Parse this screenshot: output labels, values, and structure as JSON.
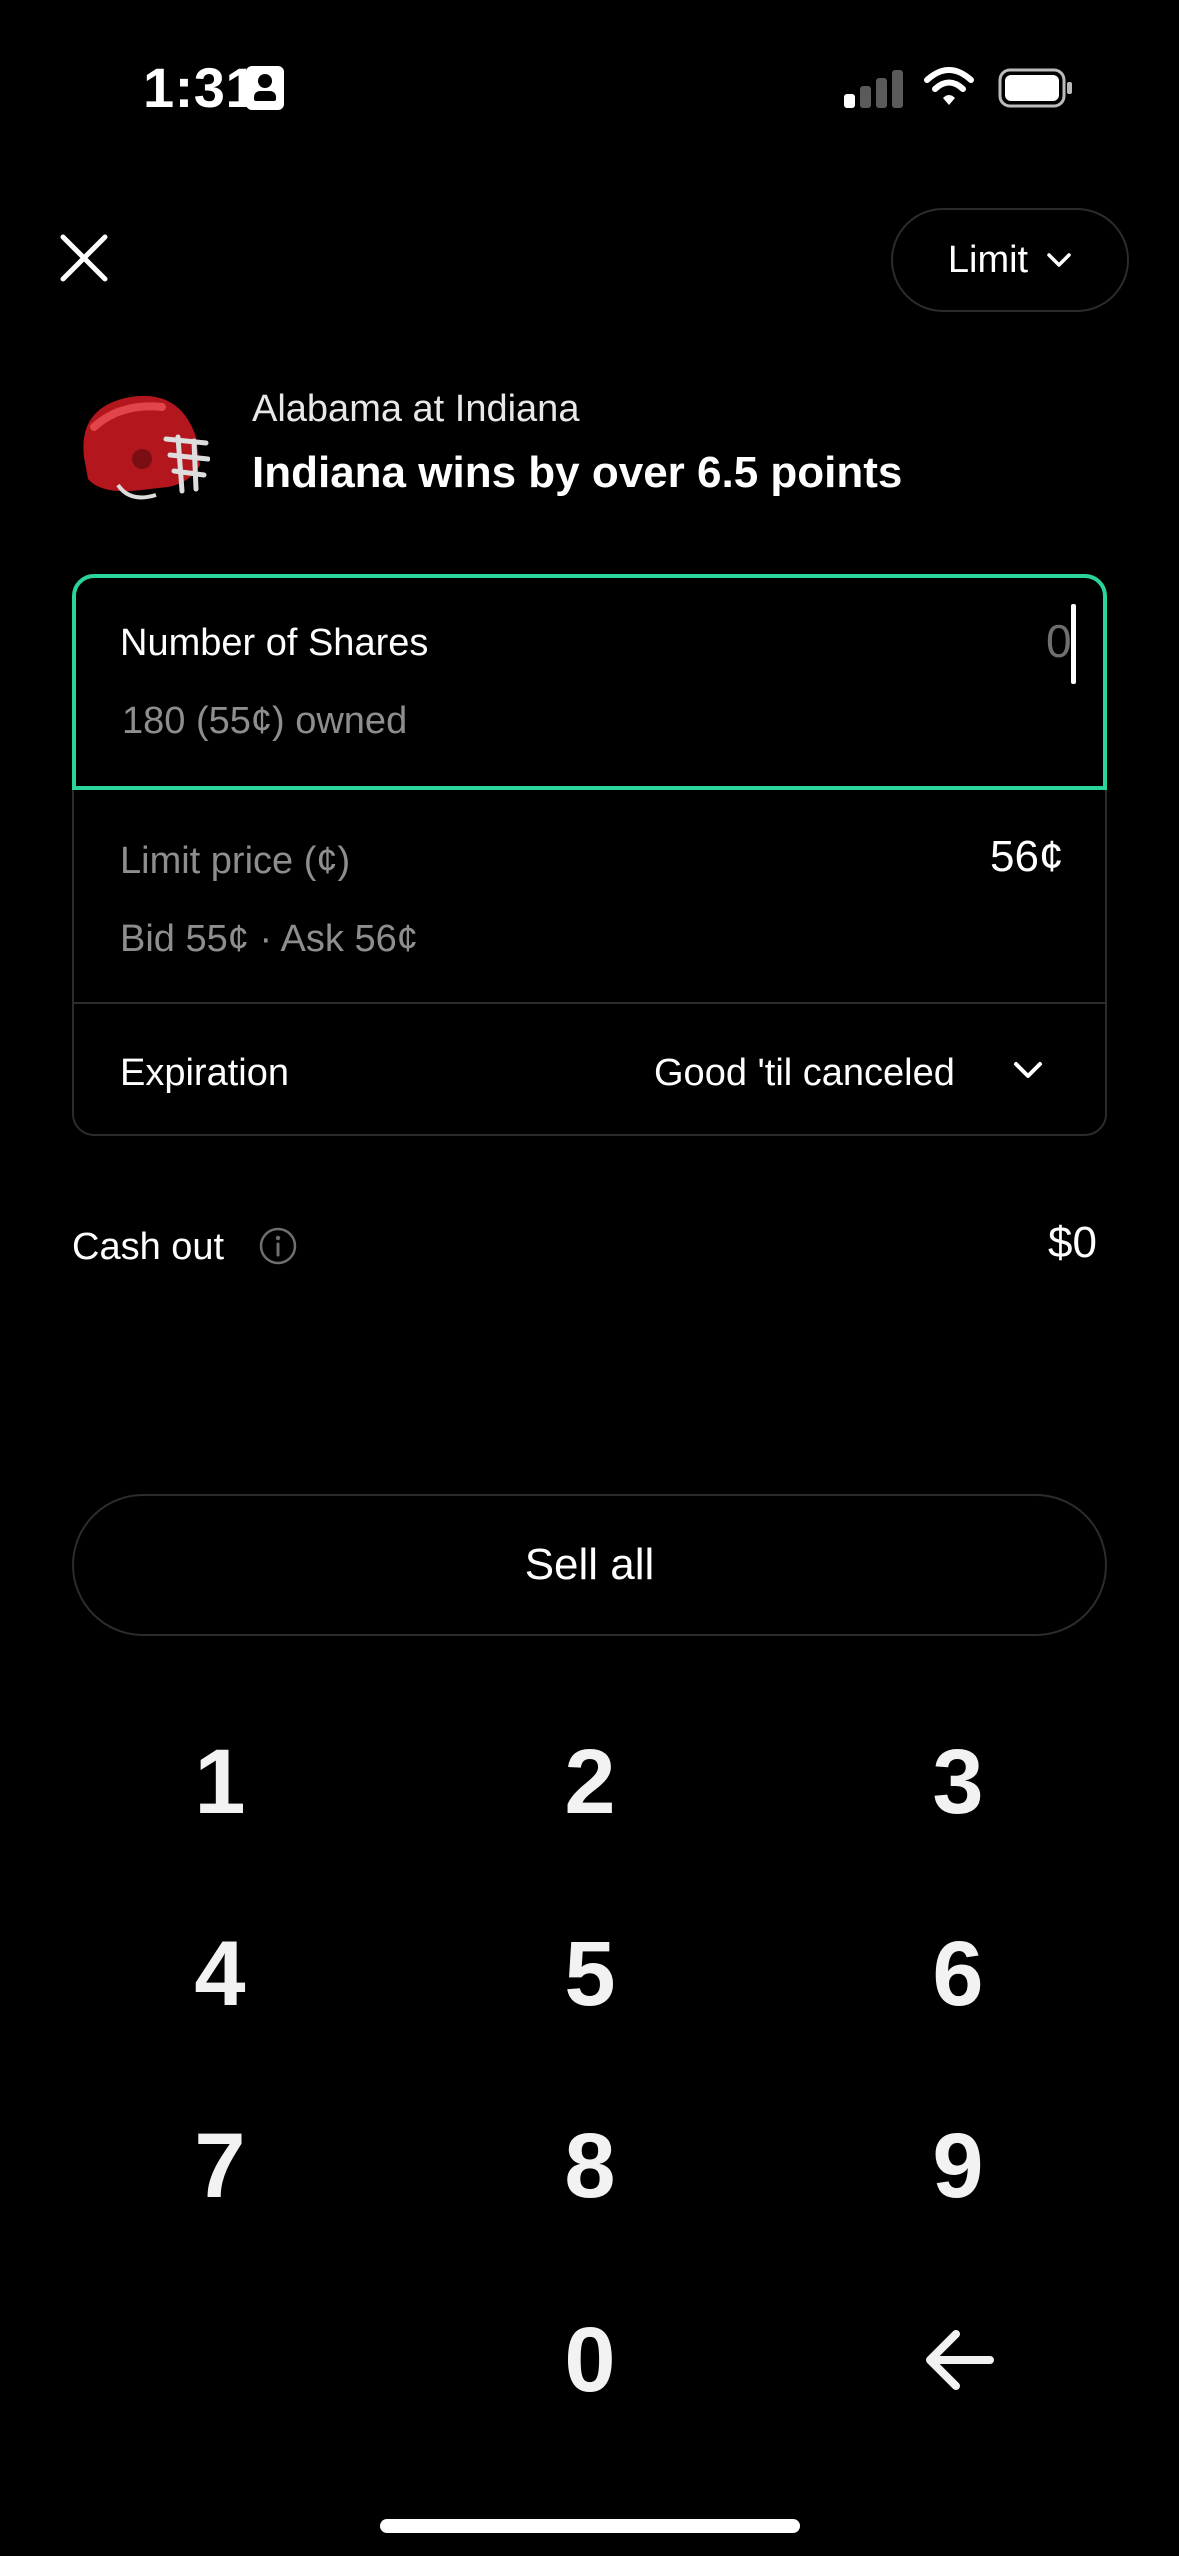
{
  "status_bar": {
    "time": "1:31"
  },
  "header": {
    "order_type": "Limit"
  },
  "event": {
    "matchup": "Alabama at Indiana",
    "market": "Indiana wins by over 6.5 points"
  },
  "order": {
    "shares_label": "Number of Shares",
    "shares_value": "0",
    "owned_text": "180 (55¢) owned",
    "limit_label": "Limit price (¢)",
    "limit_value": "56¢",
    "bid_ask": "Bid 55¢ · Ask 56¢",
    "expiration_label": "Expiration",
    "expiration_value": "Good 'til canceled"
  },
  "cash_out": {
    "label": "Cash out",
    "value": "$0"
  },
  "sell_all_label": "Sell all",
  "keypad": [
    "1",
    "2",
    "3",
    "4",
    "5",
    "6",
    "7",
    "8",
    "9",
    "0"
  ],
  "colors": {
    "accent": "#2bd49a",
    "background": "#000000",
    "muted": "#8e8e8e"
  },
  "icons": [
    "id-card-icon",
    "signal-icon",
    "wifi-icon",
    "battery-icon",
    "close-icon",
    "chevron-down-icon",
    "helmet-icon",
    "info-icon",
    "backspace-icon"
  ]
}
